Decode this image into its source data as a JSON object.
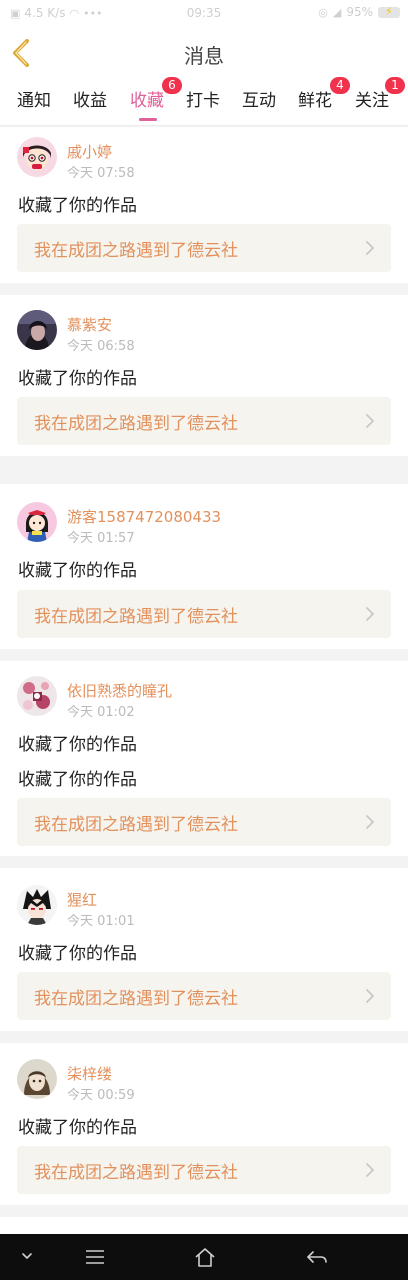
{
  "status_bar": {
    "left": "4.5 K/s",
    "time": "09:35",
    "right": "95%"
  },
  "header": {
    "title": "消息"
  },
  "tabs": [
    {
      "label": "通知",
      "badge": ""
    },
    {
      "label": "收益",
      "badge": ""
    },
    {
      "label": "收藏",
      "badge": "6",
      "active": true
    },
    {
      "label": "打卡",
      "badge": ""
    },
    {
      "label": "互动",
      "badge": ""
    },
    {
      "label": "鲜花",
      "badge": "4"
    },
    {
      "label": "关注",
      "badge": "1"
    }
  ],
  "messages": [
    {
      "user": "戚小婷",
      "time": "今天 07:58",
      "actions": [
        "收藏了你的作品"
      ],
      "work": "我在成团之路遇到了德云社",
      "avatar": "red-hair-girl-avatar"
    },
    {
      "user": "慕紫安",
      "time": "今天 06:58",
      "actions": [
        "收藏了你的作品"
      ],
      "work": "我在成团之路遇到了德云社",
      "avatar": "dark-hair-avatar"
    },
    {
      "user": "游客1587472080433",
      "time": "今天 01:57",
      "actions": [
        "收藏了你的作品"
      ],
      "work": "我在成团之路遇到了德云社",
      "avatar": "snow-white-avatar"
    },
    {
      "user": "依旧熟悉的瞳孔",
      "time": "今天 01:02",
      "actions": [
        "收藏了你的作品",
        "收藏了你的作品"
      ],
      "work": "我在成团之路遇到了德云社",
      "avatar": "flower-avatar"
    },
    {
      "user": "猩红",
      "time": "今天 01:01",
      "actions": [
        "收藏了你的作品"
      ],
      "work": "我在成团之路遇到了德云社",
      "avatar": "anime-boy-avatar"
    },
    {
      "user": "柒梓缕",
      "time": "今天 00:59",
      "actions": [
        "收藏了你的作品"
      ],
      "work": "我在成团之路遇到了德云社",
      "avatar": "doll-avatar"
    }
  ],
  "colors": {
    "accent": "#e0609a",
    "username": "#e3915c",
    "badge": "#f0324d",
    "work_box": "#f5f4ef",
    "back_icon": "#d9a93a"
  }
}
